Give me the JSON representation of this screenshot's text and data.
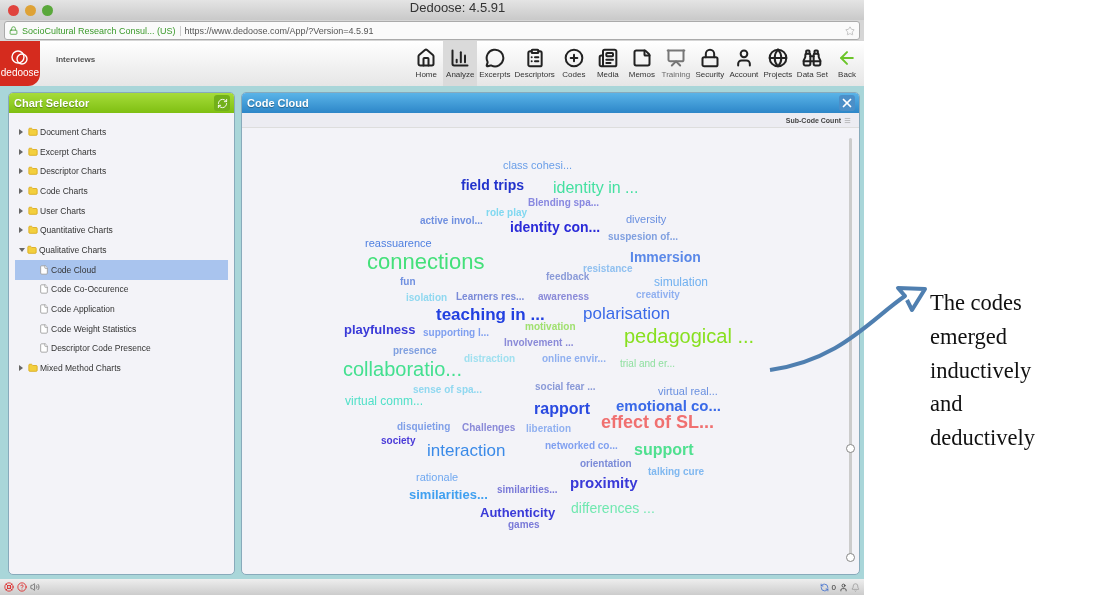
{
  "window": {
    "title": "Dedoose: 4.5.91"
  },
  "address_bar": {
    "site_identity": "SocioCultural Research Consul... (US)",
    "url": "https://www.dedoose.com/App/?Version=4.5.91"
  },
  "app_header": {
    "logo": "dedoose",
    "project": "Interviews"
  },
  "toolbar": [
    {
      "label": "Home",
      "selected": false,
      "disabled": false
    },
    {
      "label": "Analyze",
      "selected": true,
      "disabled": false
    },
    {
      "label": "Excerpts",
      "selected": false,
      "disabled": false
    },
    {
      "label": "Descriptors",
      "selected": false,
      "disabled": false
    },
    {
      "label": "Codes",
      "selected": false,
      "disabled": false
    },
    {
      "label": "Media",
      "selected": false,
      "disabled": false
    },
    {
      "label": "Memos",
      "selected": false,
      "disabled": false
    },
    {
      "label": "Training",
      "selected": false,
      "disabled": true
    },
    {
      "label": "Security",
      "selected": false,
      "disabled": false
    },
    {
      "label": "Account",
      "selected": false,
      "disabled": false
    },
    {
      "label": "Projects",
      "selected": false,
      "disabled": false
    },
    {
      "label": "Data Set",
      "selected": false,
      "disabled": false
    },
    {
      "label": "Back",
      "selected": false,
      "disabled": false
    }
  ],
  "chart_selector": {
    "title": "Chart Selector",
    "items": [
      {
        "label": "Document Charts",
        "expanded": false
      },
      {
        "label": "Excerpt Charts",
        "expanded": false
      },
      {
        "label": "Descriptor Charts",
        "expanded": false
      },
      {
        "label": "Code Charts",
        "expanded": false
      },
      {
        "label": "User Charts",
        "expanded": false
      },
      {
        "label": "Quantitative Charts",
        "expanded": false
      },
      {
        "label": "Qualitative Charts",
        "expanded": true,
        "children": [
          {
            "label": "Code Cloud",
            "selected": true
          },
          {
            "label": "Code Co-Occurence",
            "selected": false
          },
          {
            "label": "Code Application",
            "selected": false
          },
          {
            "label": "Code Weight Statistics",
            "selected": false
          },
          {
            "label": "Descriptor Code Presence",
            "selected": false
          }
        ]
      },
      {
        "label": "Mixed Method Charts",
        "expanded": false
      }
    ]
  },
  "code_cloud": {
    "title": "Code Cloud",
    "option": "Sub-Code Count",
    "slider": {
      "level": 0.26
    },
    "words": [
      {
        "text": "class cohesi...",
        "color": "#6a9ee8"
      },
      {
        "text": "field trips",
        "color": "#2233cc"
      },
      {
        "text": "identity in ...",
        "color": "#44e0a0"
      },
      {
        "text": "Blending spa...",
        "color": "#8888e0"
      },
      {
        "text": "active invol...",
        "color": "#7090e0"
      },
      {
        "text": "role play",
        "color": "#80d8f0"
      },
      {
        "text": "identity con...",
        "color": "#2a2ad8"
      },
      {
        "text": "diversity",
        "color": "#6a90e0"
      },
      {
        "text": "suspesion of...",
        "color": "#80a0e0"
      },
      {
        "text": "reassuarence",
        "color": "#5080e0"
      },
      {
        "text": "connections",
        "color": "#44e07a"
      },
      {
        "text": "fun",
        "color": "#7090e0"
      },
      {
        "text": "Immersion",
        "color": "#5a88e8"
      },
      {
        "text": "resistance",
        "color": "#90c0f0"
      },
      {
        "text": "feedback",
        "color": "#8a9ad8"
      },
      {
        "text": "simulation",
        "color": "#70b0f0"
      },
      {
        "text": "isolation",
        "color": "#90d8f0"
      },
      {
        "text": "Learners res...",
        "color": "#7a8ad8"
      },
      {
        "text": "awareness",
        "color": "#8a8ad8"
      },
      {
        "text": "creativity",
        "color": "#90b0f0"
      },
      {
        "text": "teaching in ...",
        "color": "#2240e0"
      },
      {
        "text": "polarisation",
        "color": "#3a6ae8"
      },
      {
        "text": "playfulness",
        "color": "#3a3ad8"
      },
      {
        "text": "supporting l...",
        "color": "#80a0f0"
      },
      {
        "text": "motivation",
        "color": "#a0e070"
      },
      {
        "text": "pedagogical ...",
        "color": "#88e020"
      },
      {
        "text": "presence",
        "color": "#80a0e0"
      },
      {
        "text": "collaboratio...",
        "color": "#44e090"
      },
      {
        "text": "distraction",
        "color": "#a0e0f0"
      },
      {
        "text": "Involvement ...",
        "color": "#8a8ad8"
      },
      {
        "text": "online envir...",
        "color": "#90b0f0"
      },
      {
        "text": "trial and er...",
        "color": "#90e0a0"
      },
      {
        "text": "sense of spa...",
        "color": "#90d8f0"
      },
      {
        "text": "social fear ...",
        "color": "#8a9ad8"
      },
      {
        "text": "virtual comm...",
        "color": "#50e0c8"
      },
      {
        "text": "virtual real...",
        "color": "#6a90e0"
      },
      {
        "text": "rapport",
        "color": "#2a4ae0"
      },
      {
        "text": "emotional co...",
        "color": "#3a6ae8"
      },
      {
        "text": "effect of SL...",
        "color": "#f07070"
      },
      {
        "text": "disquieting",
        "color": "#80a0e8"
      },
      {
        "text": "Challenges",
        "color": "#8a8ad8"
      },
      {
        "text": "liberation",
        "color": "#90b0f0"
      },
      {
        "text": "society",
        "color": "#4a3ad8"
      },
      {
        "text": "interaction",
        "color": "#3a8ae8"
      },
      {
        "text": "networked co...",
        "color": "#80a0f0"
      },
      {
        "text": "support",
        "color": "#50e090"
      },
      {
        "text": "orientation",
        "color": "#7a8ad8"
      },
      {
        "text": "talking cure",
        "color": "#80b8f0"
      },
      {
        "text": "rationale",
        "color": "#70a8f0"
      },
      {
        "text": "similarities...",
        "color": "#7a7ad8"
      },
      {
        "text": "proximity",
        "color": "#3a3ad8"
      },
      {
        "text": "similarities...",
        "color": "#40a0f0"
      },
      {
        "text": "Authenticity",
        "color": "#3a3ad8"
      },
      {
        "text": "differences ...",
        "color": "#70e8b0"
      },
      {
        "text": "games",
        "color": "#7a7ad8"
      }
    ]
  },
  "status_bar": {
    "count": "0"
  },
  "annotation": {
    "text": "The codes emerged inductively and deductively"
  }
}
